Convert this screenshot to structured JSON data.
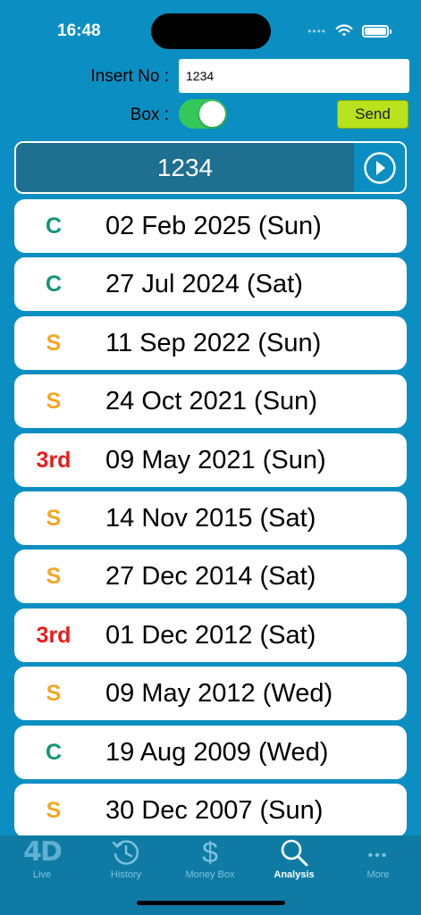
{
  "status": {
    "time": "16:48"
  },
  "form": {
    "insert_label": "Insert No :",
    "insert_value": "1234",
    "box_label": "Box :",
    "box_on": true,
    "send_label": "Send"
  },
  "header": {
    "number": "1234"
  },
  "results": [
    {
      "prize": "C",
      "kind": "c",
      "date": "02 Feb 2025 (Sun)"
    },
    {
      "prize": "C",
      "kind": "c",
      "date": "27 Jul 2024 (Sat)"
    },
    {
      "prize": "S",
      "kind": "s",
      "date": "11 Sep 2022 (Sun)"
    },
    {
      "prize": "S",
      "kind": "s",
      "date": "24 Oct 2021 (Sun)"
    },
    {
      "prize": "3rd",
      "kind": "third",
      "date": "09 May 2021 (Sun)"
    },
    {
      "prize": "S",
      "kind": "s",
      "date": "14 Nov 2015 (Sat)"
    },
    {
      "prize": "S",
      "kind": "s",
      "date": "27 Dec 2014 (Sat)"
    },
    {
      "prize": "3rd",
      "kind": "third",
      "date": "01 Dec 2012 (Sat)"
    },
    {
      "prize": "S",
      "kind": "s",
      "date": "09 May 2012 (Wed)"
    },
    {
      "prize": "C",
      "kind": "c",
      "date": "19 Aug 2009 (Wed)"
    },
    {
      "prize": "S",
      "kind": "s",
      "date": "30 Dec 2007 (Sun)"
    }
  ],
  "tabs": [
    {
      "label": "Live",
      "icon": "4d-logo-icon",
      "icon_text": "4D",
      "active": false
    },
    {
      "label": "History",
      "icon": "history-clock-icon",
      "active": false
    },
    {
      "label": "Money Box",
      "icon": "dollar-icon",
      "icon_text": "$",
      "active": false
    },
    {
      "label": "Analysis",
      "icon": "magnifier-icon",
      "active": true
    },
    {
      "label": "More",
      "icon": "more-dots-icon",
      "icon_text": "•••",
      "active": false
    }
  ],
  "colors": {
    "background": "#0b8fc2",
    "prize_c": "#0f9678",
    "prize_s": "#f5a623",
    "prize_third": "#e81c1c",
    "send_button": "#b7e21c",
    "toggle_on": "#34c759"
  }
}
